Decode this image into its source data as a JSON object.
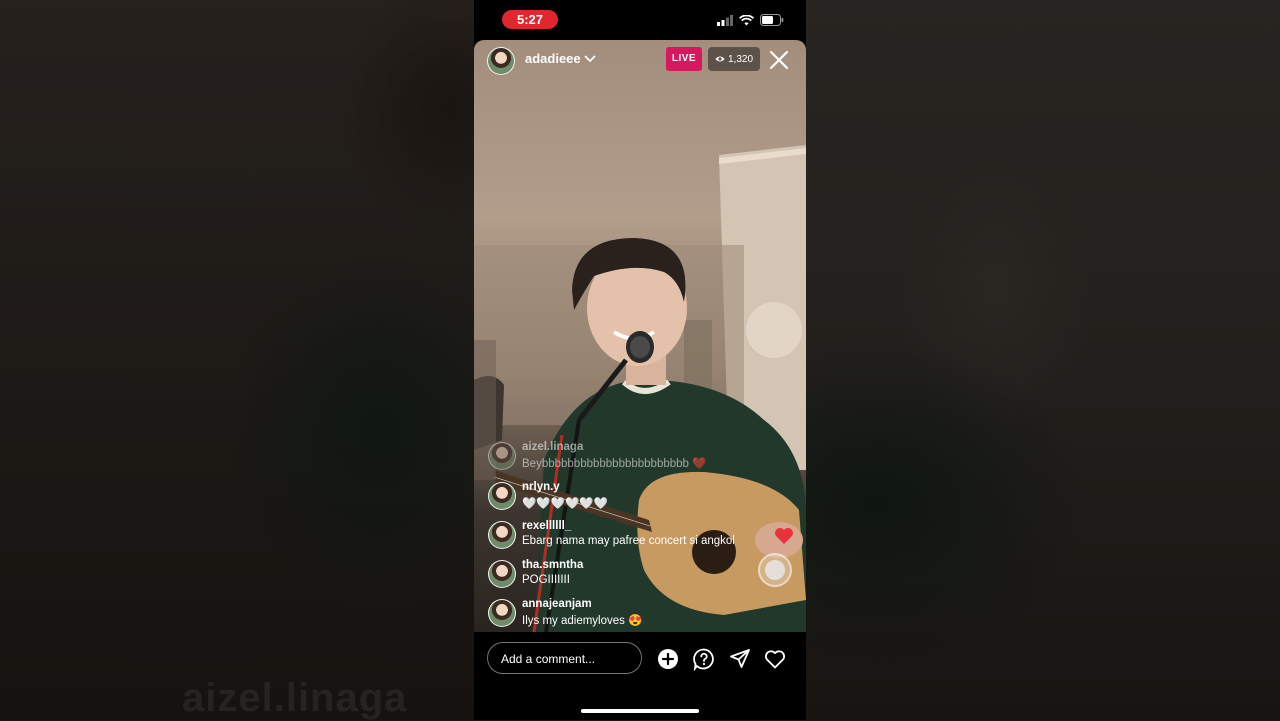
{
  "status_bar": {
    "time": "5:27"
  },
  "live": {
    "host_username": "adadieee",
    "live_label": "LIVE",
    "viewer_count": "1,320"
  },
  "comments": [
    {
      "username": "aizel.linaga",
      "text": "Beybbbbbbbbbbbbbbbbbbbbbbb ❤️"
    },
    {
      "username": "nrlyn.y",
      "text": "🤍🤍🤍🤍🤍🤍"
    },
    {
      "username": "rexellllll_",
      "text": "Ebarg nama may pafree concert si angkol"
    },
    {
      "username": "tha.smntha",
      "text": "POGIIIIIII"
    },
    {
      "username": "annajeanjam",
      "text": "Ilys my adiemyloves 😍"
    }
  ],
  "comment_box": {
    "placeholder": "Add a comment..."
  },
  "background_watermark": "aizel.linaga",
  "icons": [
    "add-icon",
    "question-icon",
    "send-icon",
    "heart-icon",
    "close-icon",
    "eye-icon",
    "chevron-down-icon"
  ],
  "colors": {
    "live_badge": "#d6185f",
    "time_pill": "#e0262f"
  }
}
